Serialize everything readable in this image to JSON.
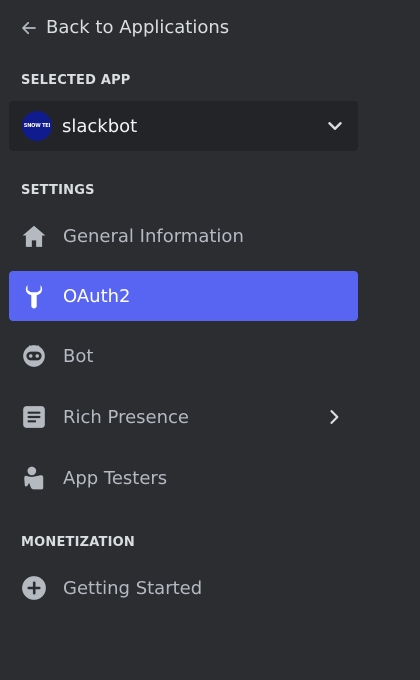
{
  "back": {
    "label": "Back to Applications"
  },
  "selected_app": {
    "header": "SELECTED APP",
    "name": "slackbot",
    "avatar_text": "SNOW TEI"
  },
  "settings": {
    "header": "SETTINGS",
    "items": [
      {
        "label": "General Information",
        "icon": "home-icon"
      },
      {
        "label": "OAuth2",
        "icon": "wrench-icon",
        "active": true
      },
      {
        "label": "Bot",
        "icon": "robot-icon"
      },
      {
        "label": "Rich Presence",
        "icon": "document-icon",
        "has_submenu": true
      },
      {
        "label": "App Testers",
        "icon": "user-tester-icon"
      }
    ]
  },
  "monetization": {
    "header": "MONETIZATION",
    "items": [
      {
        "label": "Getting Started",
        "icon": "plus-circle-icon"
      }
    ]
  },
  "colors": {
    "background": "#2b2d31",
    "select_background": "#232428",
    "accent": "#5865f2",
    "icon": "#b5bac1"
  }
}
